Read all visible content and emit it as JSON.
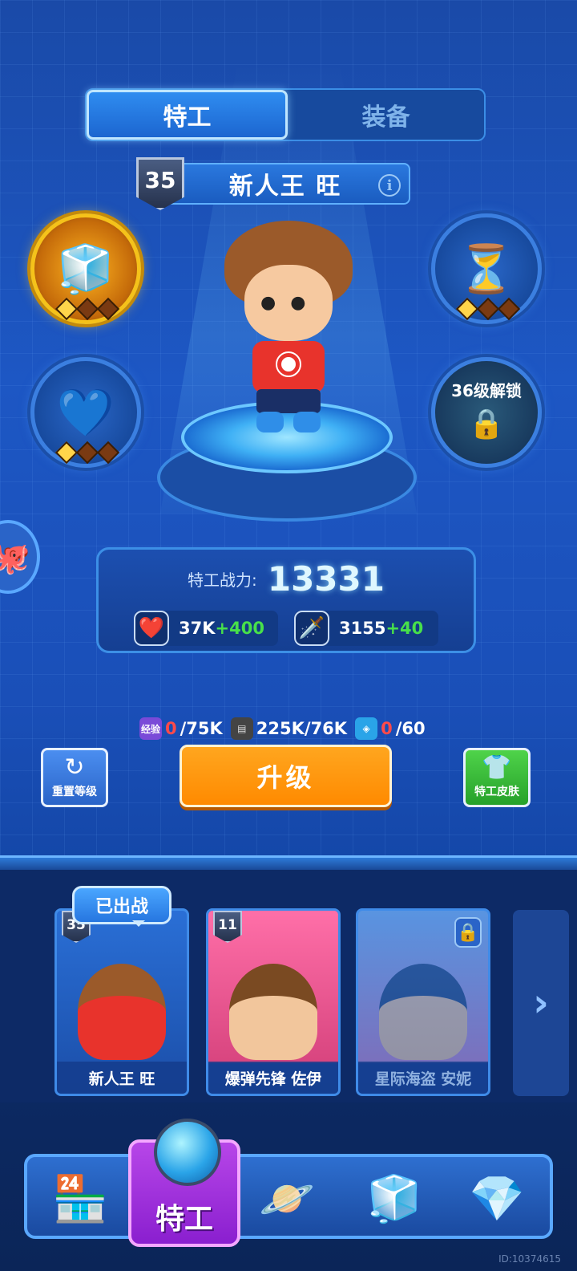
{
  "tabs": [
    {
      "label": "特工",
      "active": true
    },
    {
      "label": "装备",
      "active": false
    }
  ],
  "agent": {
    "level": "35",
    "name": "新人王 旺"
  },
  "skills": {
    "left_top": {
      "icon": "blue-cubes-icon",
      "stars_on": 1,
      "stars_total": 3
    },
    "right_top": {
      "icon": "golden-hourglass-icon",
      "stars_on": 1,
      "stars_total": 3
    },
    "left_mid": {
      "icon": "cube-hearts-icon",
      "stars_on": 1,
      "stars_total": 3
    },
    "right_mid": {
      "lock_text": "36级解锁",
      "icon": "lock-icon"
    }
  },
  "stats": {
    "power_label": "特工战力:",
    "power_value": "13331",
    "hp_value": "37K",
    "hp_bonus": "+400",
    "atk_value": "3155",
    "atk_bonus": "+40"
  },
  "resources": {
    "exp_label": "经验",
    "exp_current": "0",
    "exp_required": "/75K",
    "cash_value": "225K/76K",
    "chip_current": "0",
    "chip_required": "/60"
  },
  "buttons": {
    "reset_label": "重置等级",
    "upgrade_label": "升级",
    "skin_label": "特工皮肤"
  },
  "roster": {
    "deployed_label": "已出战",
    "cards": [
      {
        "name": "新人王 旺",
        "level": "35",
        "locked": false
      },
      {
        "name": "爆弹先锋 佐伊",
        "level": "11",
        "locked": false
      },
      {
        "name": "星际海盗 安妮",
        "level": "",
        "locked": true
      }
    ]
  },
  "nav": {
    "active_label": "特工",
    "items": [
      "shop-icon",
      "agent-icon",
      "planet-icon",
      "cube-icon",
      "gem-card-icon"
    ]
  },
  "footer_id": "ID:10374615",
  "colors": {
    "accent_blue": "#2f8cf0",
    "upgrade_orange": "#ff8a00",
    "skin_green": "#26a12a",
    "bonus_green": "#48e04a",
    "nav_purple": "#8a1fcf"
  }
}
